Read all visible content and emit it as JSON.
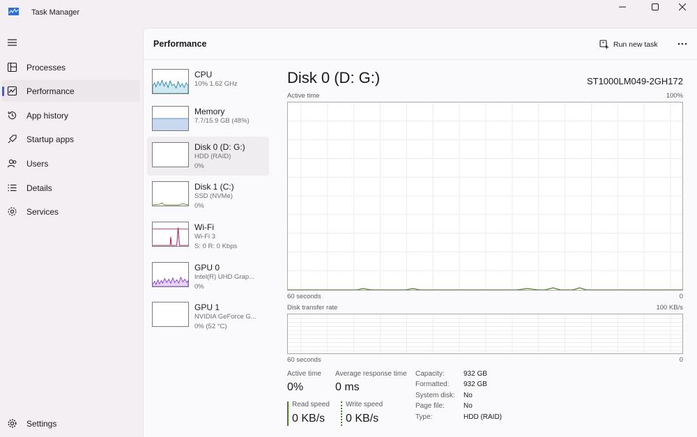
{
  "window": {
    "title": "Task Manager"
  },
  "sidebar": {
    "items": [
      {
        "label": "Processes",
        "icon": "processes-icon"
      },
      {
        "label": "Performance",
        "icon": "performance-icon",
        "active": true
      },
      {
        "label": "App history",
        "icon": "history-icon"
      },
      {
        "label": "Startup apps",
        "icon": "startup-icon"
      },
      {
        "label": "Users",
        "icon": "users-icon"
      },
      {
        "label": "Details",
        "icon": "details-icon"
      },
      {
        "label": "Services",
        "icon": "services-icon"
      }
    ],
    "settings_label": "Settings"
  },
  "header": {
    "title": "Performance",
    "run_task_label": "Run new task"
  },
  "devices": [
    {
      "name": "CPU",
      "sub1": "10%  1.62 GHz",
      "sub2": ""
    },
    {
      "name": "Memory",
      "sub1": "7.7/15.9 GB (48%)",
      "sub2": ""
    },
    {
      "name": "Disk 0 (D: G:)",
      "sub1": "HDD (RAID)",
      "sub2": "0%",
      "selected": true
    },
    {
      "name": "Disk 1 (C:)",
      "sub1": "SSD (NVMe)",
      "sub2": "0%"
    },
    {
      "name": "Wi-Fi",
      "sub1": "Wi-Fi 3",
      "sub2": "S: 0  R: 0 Kbps"
    },
    {
      "name": "GPU 0",
      "sub1": "Intel(R) UHD Grap...",
      "sub2": "0%"
    },
    {
      "name": "GPU 1",
      "sub1": "NVIDIA GeForce G...",
      "sub2": "0%  (52 °C)"
    }
  ],
  "detail": {
    "title": "Disk 0 (D: G:)",
    "model": "ST1000LM049-2GH172",
    "graph1": {
      "label": "Active time",
      "max": "100%",
      "time": "60 seconds",
      "min": "0"
    },
    "graph2": {
      "label": "Disk transfer rate",
      "max": "100 KB/s",
      "time": "60 seconds",
      "min": "0"
    },
    "stats": {
      "active_time_label": "Active time",
      "active_time_value": "0%",
      "avg_response_label": "Average response time",
      "avg_response_value": "0 ms",
      "read_speed_label": "Read speed",
      "read_speed_value": "0 KB/s",
      "write_speed_label": "Write speed",
      "write_speed_value": "0 KB/s"
    },
    "properties": [
      {
        "label": "Capacity:",
        "value": "932 GB"
      },
      {
        "label": "Formatted:",
        "value": "932 GB"
      },
      {
        "label": "System disk:",
        "value": "No"
      },
      {
        "label": "Page file:",
        "value": "No"
      },
      {
        "label": "Type:",
        "value": "HDD (RAID)"
      }
    ]
  },
  "colors": {
    "accent": "#4a5fc0",
    "disk_green": "#4c7b1f",
    "cpu_teal": "#1784a8",
    "memory_blue": "#6a8fc8",
    "wifi_magenta": "#a4145a",
    "gpu_purple": "#8a2bd8"
  }
}
